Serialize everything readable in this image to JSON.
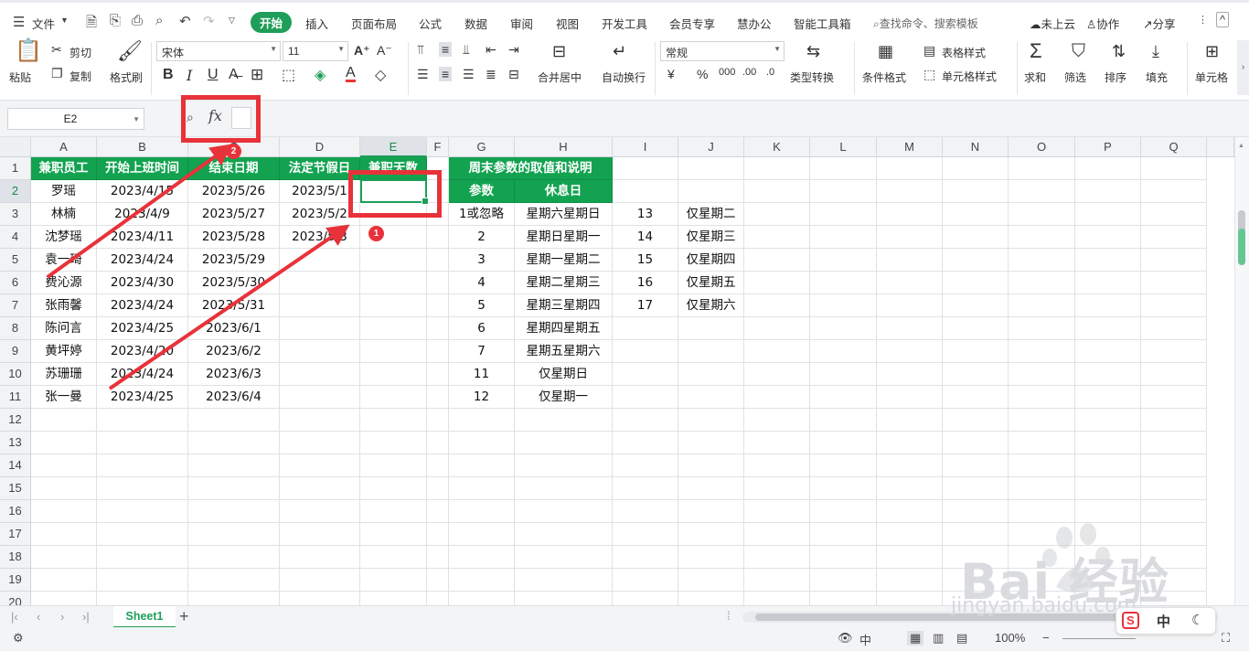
{
  "menubar": {
    "file": "文件",
    "tabs": [
      "开始",
      "插入",
      "页面布局",
      "公式",
      "数据",
      "审阅",
      "视图",
      "开发工具",
      "会员专享",
      "慧办公",
      "智能工具箱"
    ],
    "search": "查找命令、搜索模板",
    "cloud": "未上云",
    "collab": "协作",
    "share": "分享"
  },
  "ribbon": {
    "paste": "粘贴",
    "cut": "剪切",
    "copy": "复制",
    "format_painter": "格式刷",
    "font_name": "宋体",
    "font_size": "11",
    "merge_center": "合并居中",
    "wrap_text": "自动换行",
    "number_format": "常规",
    "type_convert": "类型转换",
    "cond_format": "条件格式",
    "table_style": "表格样式",
    "cell_style": "单元格样式",
    "sum": "求和",
    "filter": "筛选",
    "sort": "排序",
    "fill": "填充",
    "cells": "单元格"
  },
  "formula": {
    "name_box": "E2",
    "fx": "fx"
  },
  "grid": {
    "columns": [
      "A",
      "B",
      "C",
      "D",
      "E",
      "F",
      "G",
      "H",
      "I",
      "J",
      "K",
      "L",
      "M",
      "N",
      "O",
      "P",
      "Q"
    ],
    "rows": [
      "1",
      "2",
      "3",
      "4",
      "5",
      "6",
      "7",
      "8",
      "9",
      "10",
      "11",
      "12",
      "13",
      "14",
      "15",
      "16",
      "17",
      "18",
      "19",
      "20"
    ],
    "header_row": [
      "兼职员工",
      "开始上班时间",
      "结束日期",
      "法定节假日",
      "兼职天数"
    ],
    "data": [
      [
        "罗瑶",
        "2023/4/15",
        "2023/5/26",
        "2023/5/1"
      ],
      [
        "林楠",
        "2023/4/9",
        "2023/5/27",
        "2023/5/2"
      ],
      [
        "沈梦瑶",
        "2023/4/11",
        "2023/5/28",
        "2023/5/3"
      ],
      [
        "袁一琦",
        "2023/4/24",
        "2023/5/29",
        ""
      ],
      [
        "费沁源",
        "2023/4/30",
        "2023/5/30",
        ""
      ],
      [
        "张雨馨",
        "2023/4/24",
        "2023/5/31",
        ""
      ],
      [
        "陈问言",
        "2023/4/25",
        "2023/6/1",
        ""
      ],
      [
        "黄坪婷",
        "2023/4/20",
        "2023/6/2",
        ""
      ],
      [
        "苏珊珊",
        "2023/4/24",
        "2023/6/3",
        ""
      ],
      [
        "张一曼",
        "2023/4/25",
        "2023/6/4",
        ""
      ]
    ],
    "weekend_title": "周末参数的取值和说明",
    "weekend_header": [
      "参数",
      "休息日"
    ],
    "weekend_params": [
      [
        "1或忽略",
        "星期六星期日"
      ],
      [
        "2",
        "星期日星期一"
      ],
      [
        "3",
        "星期一星期二"
      ],
      [
        "4",
        "星期二星期三"
      ],
      [
        "5",
        "星期三星期四"
      ],
      [
        "6",
        "星期四星期五"
      ],
      [
        "7",
        "星期五星期六"
      ],
      [
        "11",
        "仅星期日"
      ],
      [
        "12",
        "仅星期一"
      ]
    ],
    "weekend_params2": [
      [
        "13",
        "仅星期二"
      ],
      [
        "14",
        "仅星期三"
      ],
      [
        "15",
        "仅星期四"
      ],
      [
        "16",
        "仅星期五"
      ],
      [
        "17",
        "仅星期六"
      ]
    ]
  },
  "sheetbar": {
    "sheet_name": "Sheet1"
  },
  "status": {
    "ime_label": "中",
    "zoom": "100%"
  },
  "annotations": {
    "badge1": "1",
    "badge2": "2"
  },
  "watermark": {
    "brand": "Bai  经验",
    "url": "jingyan.baidu.com"
  },
  "colors": {
    "accent": "#1e9e58",
    "header_fill": "#12a250",
    "annotation_red": "#e8323a"
  }
}
